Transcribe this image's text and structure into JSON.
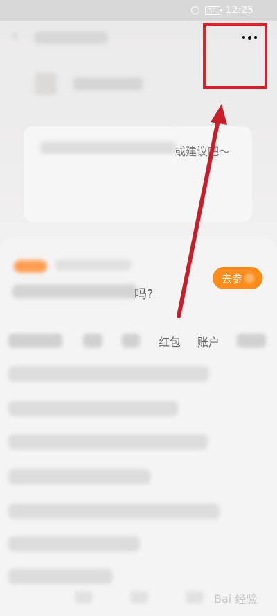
{
  "status": {
    "time": "12:25",
    "battery": "50"
  },
  "header": {
    "more_icon": "more-dots-icon",
    "back_icon": "back-arrow-icon"
  },
  "feedback": {
    "placeholder_suffix": "或建议吧～"
  },
  "survey": {
    "question_suffix": "吗?",
    "button_label": "去参"
  },
  "tabs": [
    {
      "label": "红包"
    },
    {
      "label": "账户"
    }
  ],
  "annotation": {
    "box_color": "#d6202a",
    "arrow_color": "#c81e2a"
  },
  "watermark": "Bai 经验"
}
